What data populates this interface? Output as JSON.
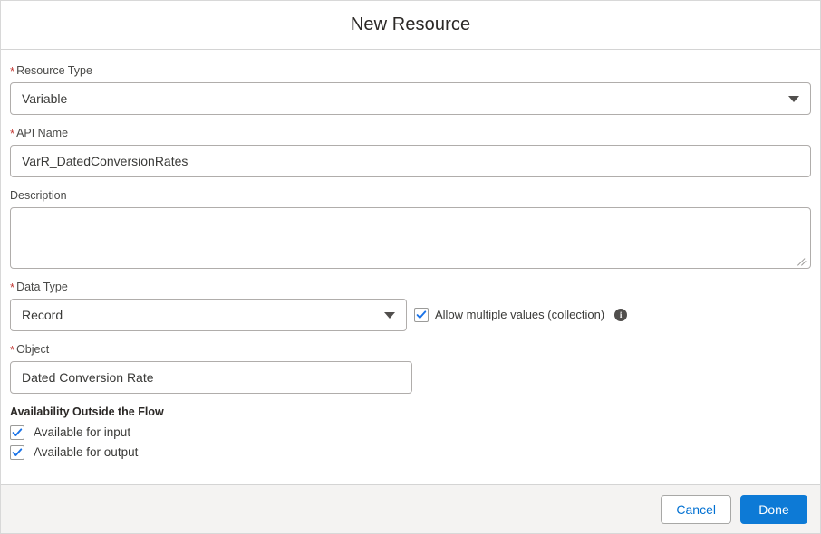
{
  "header": {
    "title": "New Resource"
  },
  "form": {
    "resource_type": {
      "label": "Resource Type",
      "required_marker": "*",
      "value": "Variable",
      "icon": "chevron-down-icon"
    },
    "api_name": {
      "label": "API Name",
      "required_marker": "*",
      "value": "VarR_DatedConversionRates",
      "placeholder": ""
    },
    "description": {
      "label": "Description",
      "value": "",
      "placeholder": ""
    },
    "data_type": {
      "label": "Data Type",
      "required_marker": "*",
      "value": "Record",
      "icon": "chevron-down-icon"
    },
    "allow_multiple": {
      "label": "Allow multiple values (collection)",
      "checked": true,
      "info_icon": "info-icon",
      "info_glyph": "i"
    },
    "object": {
      "label": "Object",
      "required_marker": "*",
      "value": "Dated Conversion Rate",
      "placeholder": ""
    },
    "availability": {
      "section_label": "Availability Outside the Flow",
      "items": [
        {
          "label": "Available for input",
          "checked": true
        },
        {
          "label": "Available for output",
          "checked": true
        }
      ]
    }
  },
  "footer": {
    "cancel_label": "Cancel",
    "done_label": "Done"
  },
  "colors": {
    "brand_blue": "#0d7ad6",
    "link_blue": "#0070d2",
    "required_red": "#c23934",
    "footer_bg": "#f4f3f2",
    "border_gray": "#b0adab"
  }
}
